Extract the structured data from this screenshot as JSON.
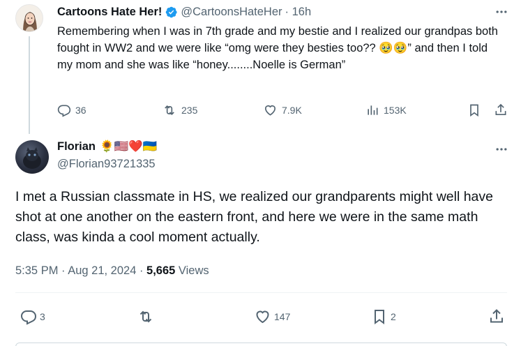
{
  "parent": {
    "display_name": "Cartoons Hate Her!",
    "handle": "@CartoonsHateHer",
    "time": "· 16h",
    "text": "Remembering when I was in 7th grade and my bestie and I realized our grandpas both fought in WW2 and we were like “omg were they besties too?? 🥹🥹” and then I told my mom and she was like “honey........Noelle is German”",
    "stats": {
      "replies": "36",
      "reposts": "235",
      "likes": "7.9K",
      "views": "153K"
    }
  },
  "reply": {
    "display_name": "Florian",
    "name_emojis": "🌻🇺🇸❤️🇺🇦",
    "handle": "@Florian93721335",
    "text": "I met a Russian classmate in HS, we realized our grandparents might well have shot at one another on the eastern front, and here we were in the same math class, was kinda a cool moment actually.",
    "timestamp": "5:35 PM · Aug 21, 2024 · ",
    "views_count": "5,665",
    "views_label": " Views",
    "stats": {
      "replies": "3",
      "reposts": "",
      "likes": "147",
      "bookmarks": "2"
    }
  },
  "icons": {
    "verified": "verified-badge-icon",
    "reply": "reply-icon",
    "repost": "repost-icon",
    "like": "heart-icon",
    "views": "views-icon",
    "bookmark": "bookmark-icon",
    "share": "share-icon",
    "more": "more-icon"
  },
  "colors": {
    "verified": "#1d9bf0",
    "text": "#0f1419",
    "secondary": "#536471",
    "thread_line": "#cfd9de"
  }
}
